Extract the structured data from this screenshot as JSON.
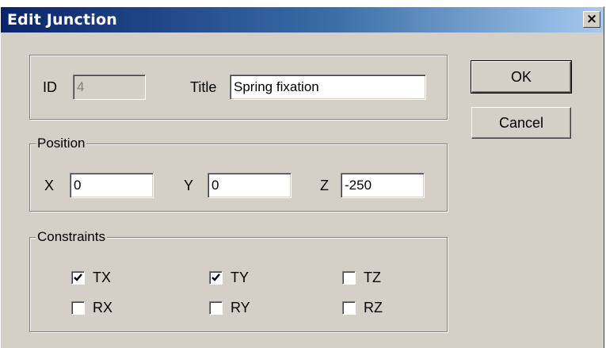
{
  "window": {
    "title": "Edit Junction",
    "close_glyph": "✕"
  },
  "ident": {
    "id_label": "ID",
    "id_value": "4",
    "title_label": "Title",
    "title_value": "Spring fixation"
  },
  "position": {
    "legend": "Position",
    "x_label": "X",
    "x_value": "0",
    "y_label": "Y",
    "y_value": "0",
    "z_label": "Z",
    "z_value": "-250"
  },
  "constraints": {
    "legend": "Constraints",
    "items": [
      {
        "label": "TX",
        "checked": true
      },
      {
        "label": "TY",
        "checked": true
      },
      {
        "label": "TZ",
        "checked": false
      },
      {
        "label": "RX",
        "checked": false
      },
      {
        "label": "RY",
        "checked": false
      },
      {
        "label": "RZ",
        "checked": false
      }
    ]
  },
  "buttons": {
    "ok": "OK",
    "cancel": "Cancel"
  }
}
